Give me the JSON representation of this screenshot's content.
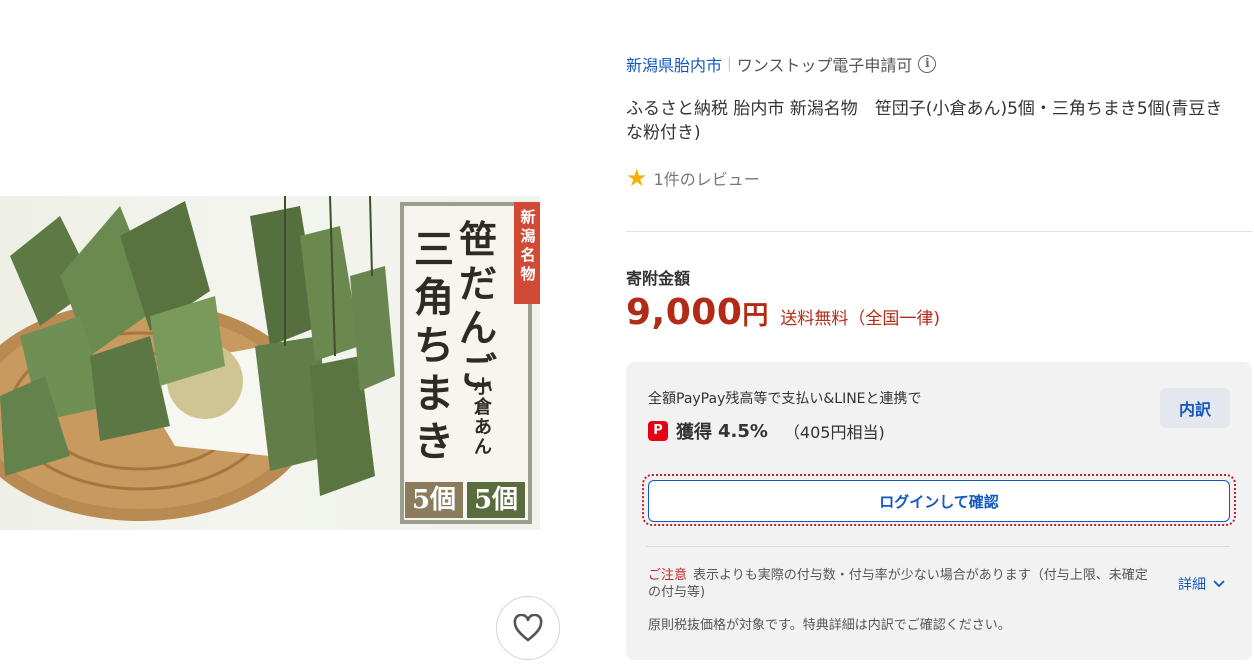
{
  "product_image": {
    "tag_text": "新潟名物",
    "title_line_1": "笹だんご",
    "title_line_2": "三角ちまき",
    "subtitle": "小倉あん",
    "badge_1": "5個",
    "badge_2": "5個"
  },
  "favorite": {
    "icon": "heart-icon"
  },
  "header": {
    "municipality": "新潟県胎内市",
    "onestop": "ワンストップ電子申請可",
    "info_icon": "i"
  },
  "product": {
    "title": "ふるさと納税 胎内市 新潟名物　笹団子(小倉あん)5個・三角ちまき5個(青豆きな粉付き)"
  },
  "review": {
    "text": "1件のレビュー"
  },
  "price": {
    "label": "寄附金額",
    "amount": "9,000",
    "unit": "円",
    "shipping": "送料無料（全国一律)"
  },
  "points": {
    "description": "全額PayPay残高等で支払い&LINEと連携で",
    "paypay_icon_text": "P",
    "earn_label": "獲得",
    "earn_rate": "4.5%",
    "earn_equivalent": "（405円相当)",
    "breakdown_label": "内訳",
    "login_label": "ログインして確認",
    "notice_label": "ご注意",
    "notice_text": "表示よりも実際の付与数・付与率が少ない場合があります（付与上限、未確定の付与等)",
    "details_label": "詳細",
    "tax_note": "原則税抜価格が対象です。特典詳細は内訳でご確認ください。"
  },
  "colors": {
    "link_blue": "#1457c0",
    "price_red": "#b22b16",
    "star_yellow": "#f0b10b",
    "paypay_red": "#e60012"
  }
}
